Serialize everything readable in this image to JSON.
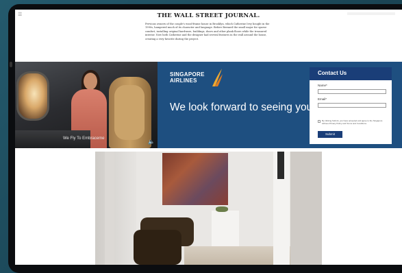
{
  "article": {
    "masthead": "THE WALL STREET JOURNAL.",
    "menu_icon": "menu-icon",
    "body": "Previous owners of the couple's wood-frame house in Brooklyn, which Catherine Ivey bought in the 1990s, hampered much of its character and language. Before Bernard the small major for sparse comfort, installing original hardware, buildings, doors and other plank floors while the treasured interior. Now both Catherine and the designer had several features in the wall around the house, creating a very favorite during the project."
  },
  "ad": {
    "photo_caption": "We Fly To Embraceme",
    "sound_icon": "speaker-icon",
    "logo_line1": "SINGAPORE",
    "logo_line2": "AIRLINES",
    "headline": "We look forward to seeing you in the air again.",
    "form": {
      "title": "Contact Us",
      "name_label": "Name*",
      "email_label": "Email*",
      "consent": "By clicking Submit, you have accepted and agree to the Singapore Airlines Privacy Policy and Terms and Conditions.",
      "submit_label": "Submit"
    }
  },
  "colors": {
    "brand_navy": "#1a3e78",
    "ad_blue": "#1e4f80",
    "background_teal": "#1c4a5c"
  }
}
